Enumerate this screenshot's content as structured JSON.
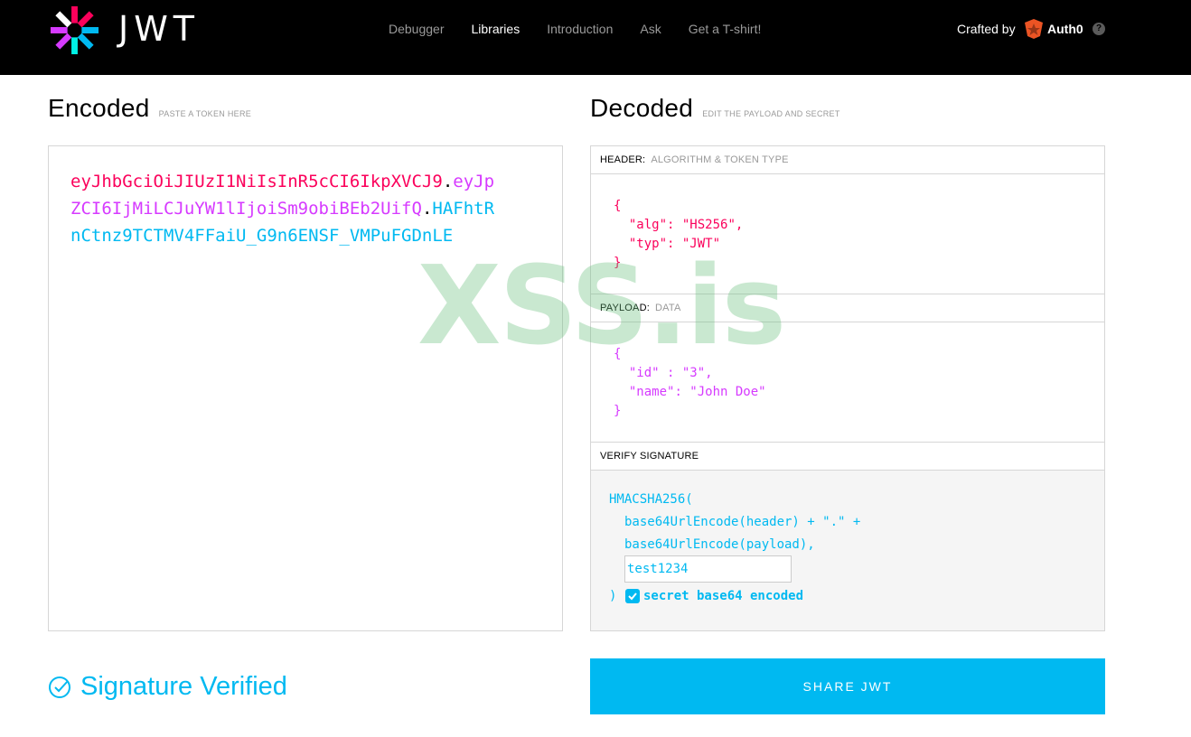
{
  "header": {
    "logo_text": "JWT",
    "nav": [
      "Debugger",
      "Libraries",
      "Introduction",
      "Ask",
      "Get a T-shirt!"
    ],
    "active_nav": "Libraries",
    "crafted_by": "Crafted by",
    "brand": "Auth0",
    "help": "?"
  },
  "encoded": {
    "title": "Encoded",
    "subtitle": "PASTE A TOKEN HERE",
    "token_header": "eyJhbGciOiJIUzI1NiIsInR5cCI6IkpXVCJ9",
    "token_payload": "eyJpZCI6IjMiLCJuYW1lIjoiSm9obiBEb2UifQ",
    "token_signature": "HAFhtRnCtnz9TCTMV4FFaiU_G9n6ENSF_VMPuFGDnLE",
    "dot": "."
  },
  "decoded": {
    "title": "Decoded",
    "subtitle": "EDIT THE PAYLOAD AND SECRET",
    "header_label": "HEADER:",
    "header_desc": "ALGORITHM & TOKEN TYPE",
    "header_json": {
      "alg_key": "\"alg\"",
      "alg_val": "\"HS256\"",
      "typ_key": "\"typ\"",
      "typ_val": "\"JWT\""
    },
    "payload_label": "PAYLOAD:",
    "payload_desc": "DATA",
    "payload_json": {
      "id_key": "\"id\"",
      "id_val": "\"3\"",
      "name_key": "\"name\"",
      "name_val": "\"John Doe\""
    },
    "verify_label": "VERIFY SIGNATURE",
    "sig_line1": "HMACSHA256(",
    "sig_line2": "base64UrlEncode(header) + \".\" +",
    "sig_line3": "base64UrlEncode(payload),",
    "secret_value": "test1234",
    "sig_close": ")",
    "secret_b64_label": "secret base64 encoded",
    "secret_b64_checked": true
  },
  "watermark": "XSS.is",
  "status": {
    "verified_label": "Signature Verified"
  },
  "share_label": "SHARE JWT",
  "colors": {
    "header_color": "#fb015b",
    "payload_color": "#d63aff",
    "signature_color": "#00b9f1"
  }
}
